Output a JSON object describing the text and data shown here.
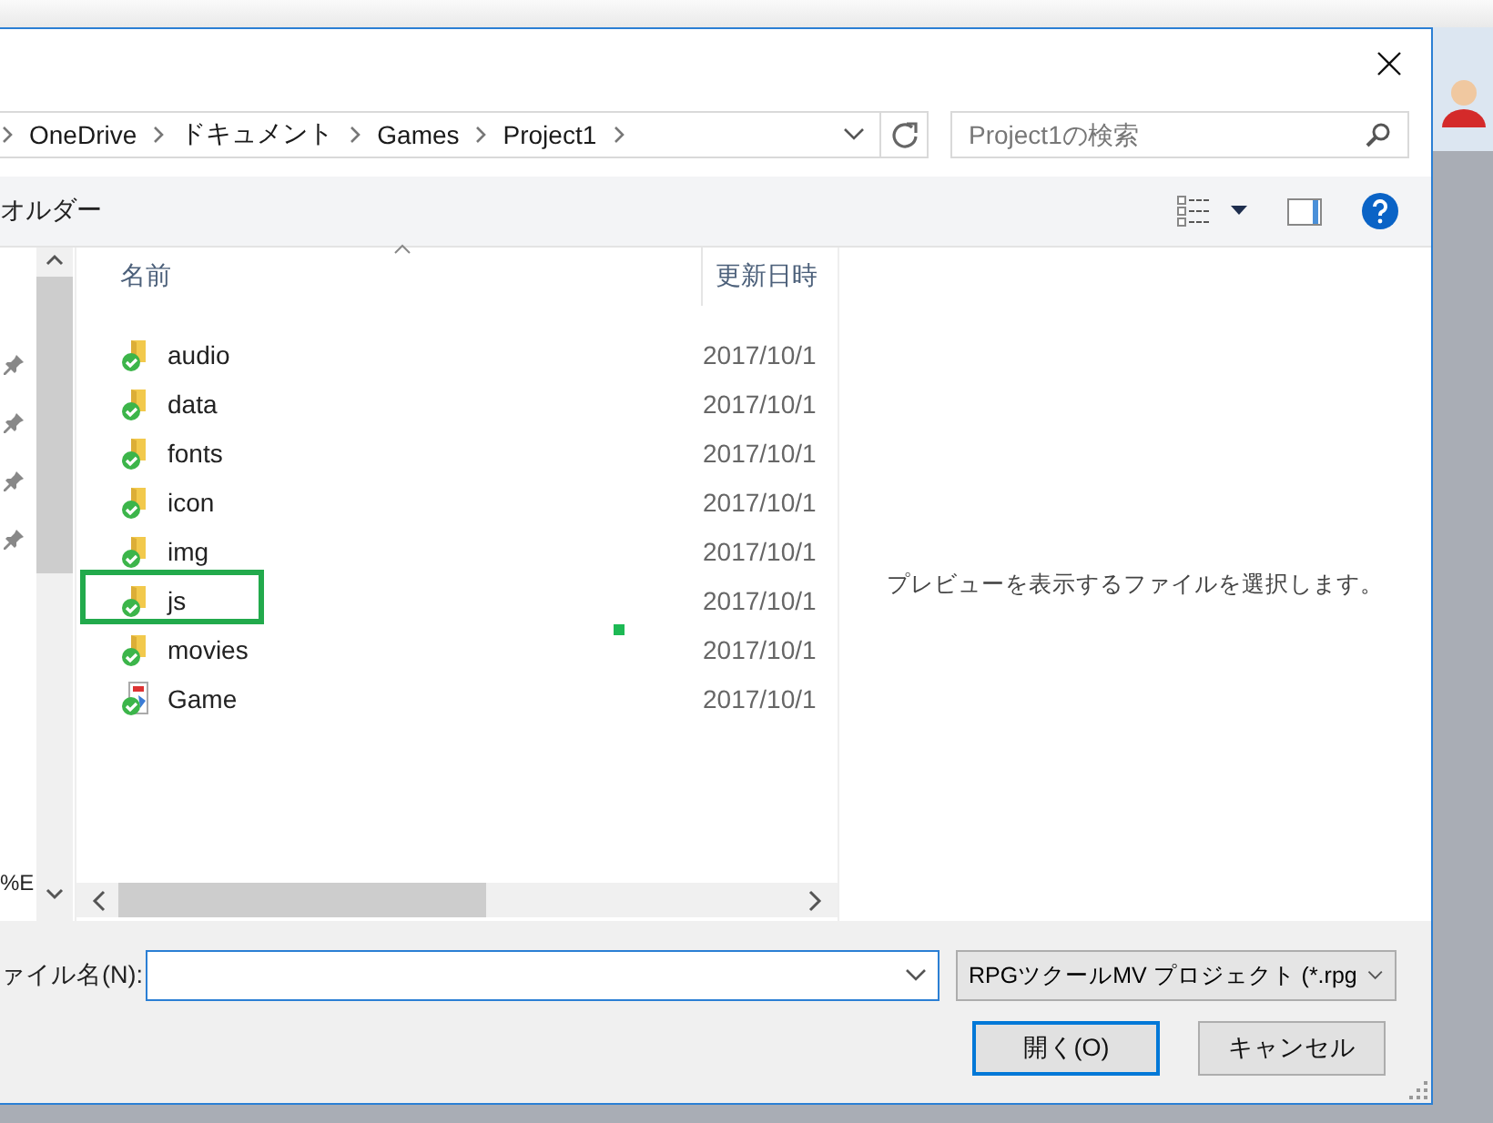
{
  "address_bar": {
    "crumbs": [
      "OneDrive",
      "ドキュメント",
      "Games",
      "Project1"
    ]
  },
  "search": {
    "placeholder": "Project1の検索"
  },
  "toolbar": {
    "label": "オルダー"
  },
  "nav_pane": {
    "text": "%E"
  },
  "columns": [
    {
      "label": "名前"
    },
    {
      "label": "更新日時"
    }
  ],
  "rows": [
    {
      "name": "audio",
      "kind": "folder",
      "date": "2017/10/1",
      "highlighted": false
    },
    {
      "name": "data",
      "kind": "folder",
      "date": "2017/10/1",
      "highlighted": false
    },
    {
      "name": "fonts",
      "kind": "folder",
      "date": "2017/10/1",
      "highlighted": false
    },
    {
      "name": "icon",
      "kind": "folder",
      "date": "2017/10/1",
      "highlighted": false
    },
    {
      "name": "img",
      "kind": "folder",
      "date": "2017/10/1",
      "highlighted": false
    },
    {
      "name": "js",
      "kind": "folder",
      "date": "2017/10/1",
      "highlighted": true
    },
    {
      "name": "movies",
      "kind": "folder",
      "date": "2017/10/1",
      "highlighted": false
    },
    {
      "name": "Game",
      "kind": "project",
      "date": "2017/10/1",
      "highlighted": false
    }
  ],
  "preview": {
    "message": "プレビューを表示するファイルを選択します。"
  },
  "filename": {
    "label": "ァイル名(N):"
  },
  "filter": {
    "value": "RPGツクールMV プロジェクト (*.rpg"
  },
  "buttons": [
    {
      "label": "開く(O)",
      "default": true
    },
    {
      "label": "キャンセル",
      "default": false
    }
  ]
}
